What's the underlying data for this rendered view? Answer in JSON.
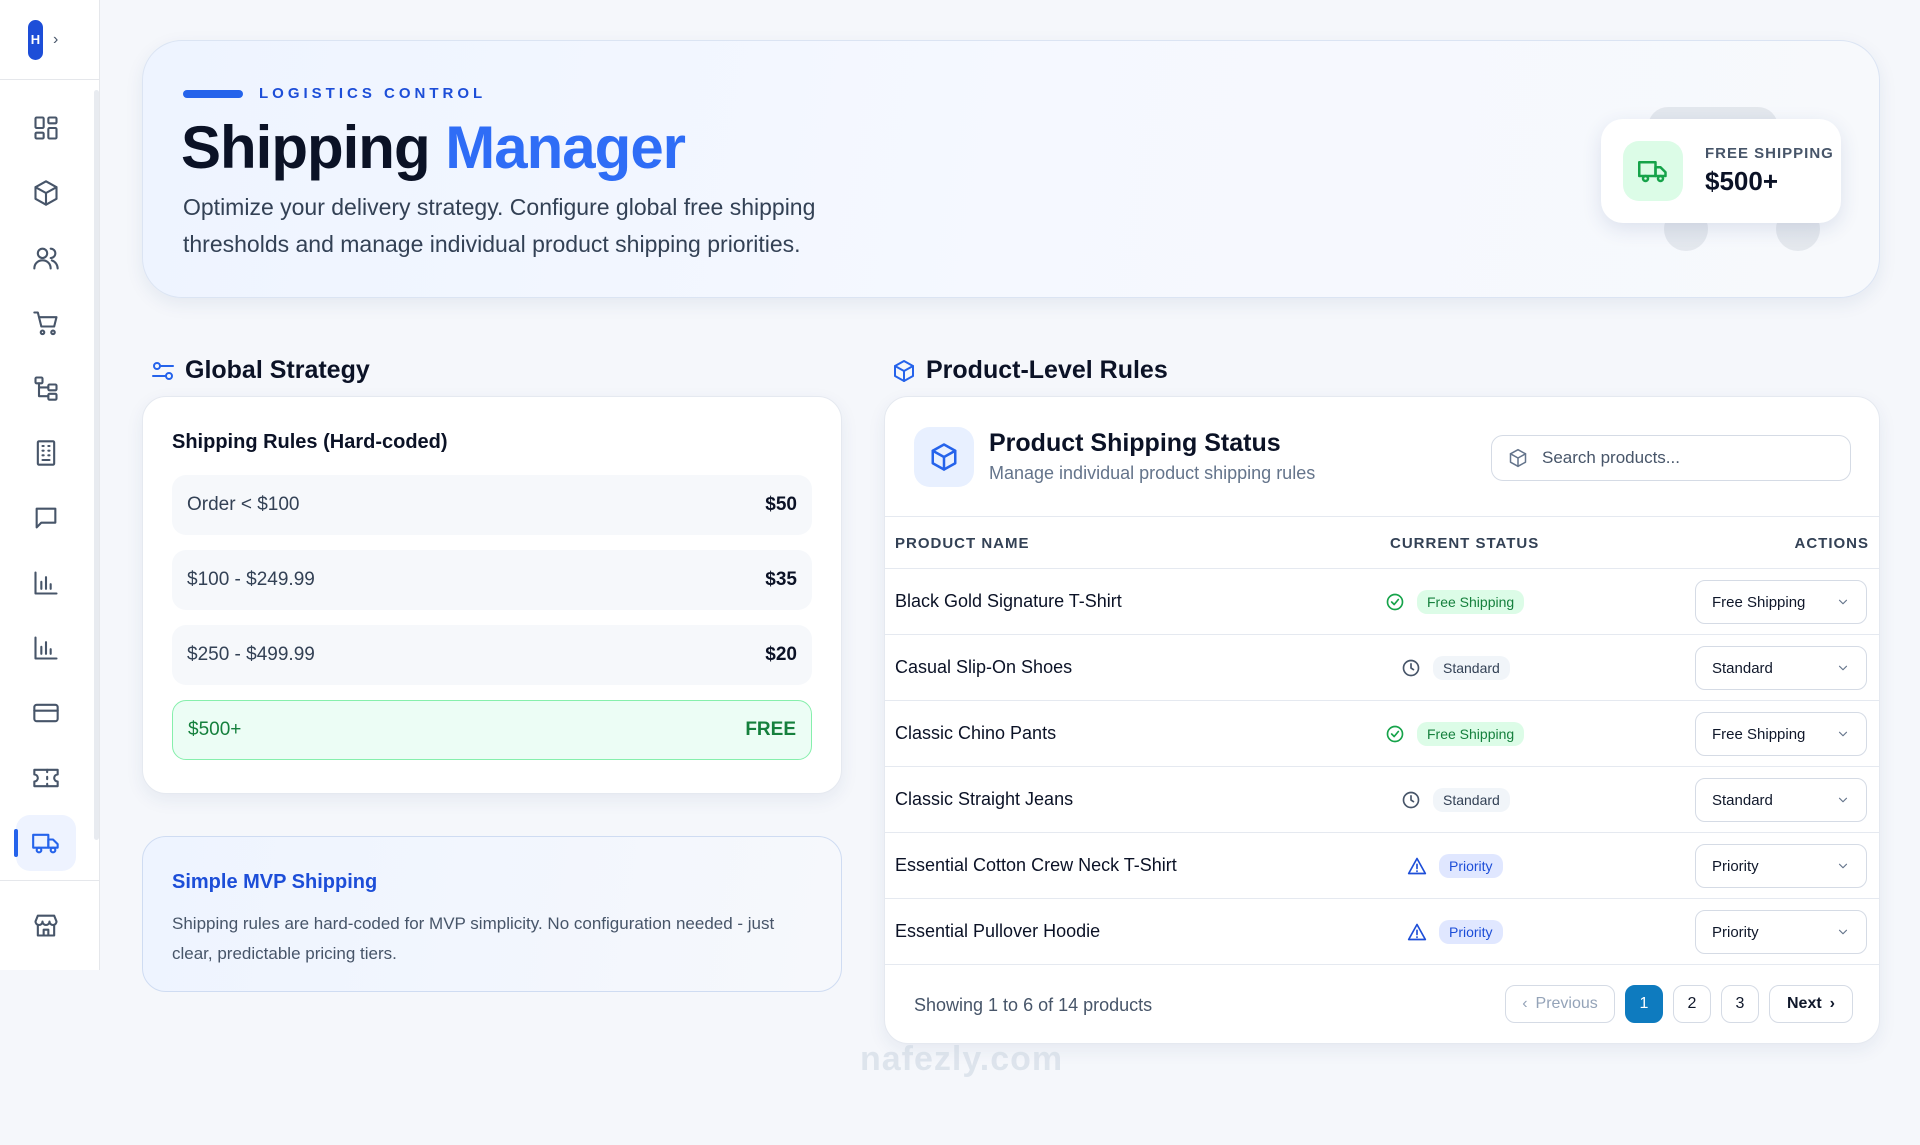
{
  "sidebar": {
    "logo_letter": "H",
    "items": [
      {
        "icon": "dashboard-icon"
      },
      {
        "icon": "package-icon"
      },
      {
        "icon": "users-icon"
      },
      {
        "icon": "cart-icon"
      },
      {
        "icon": "category-tree-icon"
      },
      {
        "icon": "building-icon"
      },
      {
        "icon": "message-icon"
      },
      {
        "icon": "bar-chart-icon"
      },
      {
        "icon": "bar-chart-icon"
      },
      {
        "icon": "credit-card-icon"
      },
      {
        "icon": "ticket-icon"
      },
      {
        "icon": "truck-icon",
        "active": true
      },
      {
        "icon": "store-icon"
      }
    ]
  },
  "hero": {
    "kicker": "LOGISTICS CONTROL",
    "title_main": "Shipping",
    "title_accent": "Manager",
    "subtitle": "Optimize your delivery strategy. Configure global free shipping thresholds and manage individual product shipping priorities.",
    "badge_label": "FREE SHIPPING",
    "badge_value": "$500+"
  },
  "global_strategy": {
    "heading": "Global Strategy",
    "card_title": "Shipping Rules (Hard-coded)",
    "rules": [
      {
        "range": "Order < $100",
        "price": "$50"
      },
      {
        "range": "$100 - $249.99",
        "price": "$35"
      },
      {
        "range": "$250 - $499.99",
        "price": "$20"
      },
      {
        "range": "$500+",
        "price": "FREE"
      }
    ],
    "note_title": "Simple MVP Shipping",
    "note_text": "Shipping rules are hard-coded for MVP simplicity. No configuration needed - just clear, predictable pricing tiers."
  },
  "products": {
    "heading": "Product-Level Rules",
    "card_title": "Product Shipping Status",
    "card_subtitle": "Manage individual product shipping rules",
    "search_placeholder": "Search products...",
    "columns": [
      "PRODUCT NAME",
      "CURRENT STATUS",
      "ACTIONS"
    ],
    "rows": [
      {
        "name": "Black Gold Signature T-Shirt",
        "status": "Free Shipping",
        "action": "Free Shipping"
      },
      {
        "name": "Casual Slip-On Shoes",
        "status": "Standard",
        "action": "Standard"
      },
      {
        "name": "Classic Chino Pants",
        "status": "Free Shipping",
        "action": "Free Shipping"
      },
      {
        "name": "Classic Straight Jeans",
        "status": "Standard",
        "action": "Standard"
      },
      {
        "name": "Essential Cotton Crew Neck T-Shirt",
        "status": "Priority",
        "action": "Priority"
      },
      {
        "name": "Essential Pullover Hoodie",
        "status": "Priority",
        "action": "Priority"
      }
    ],
    "showing": "Showing 1 to 6 of 14 products",
    "pagination": {
      "prev": "Previous",
      "pages": [
        "1",
        "2",
        "3"
      ],
      "current": "1",
      "next": "Next"
    }
  },
  "watermark": "nafezly.com",
  "colors": {
    "accent": "#2563eb",
    "free": "#16a34a",
    "priority": "#1d4ed8",
    "page_active": "#0e7bbf"
  }
}
